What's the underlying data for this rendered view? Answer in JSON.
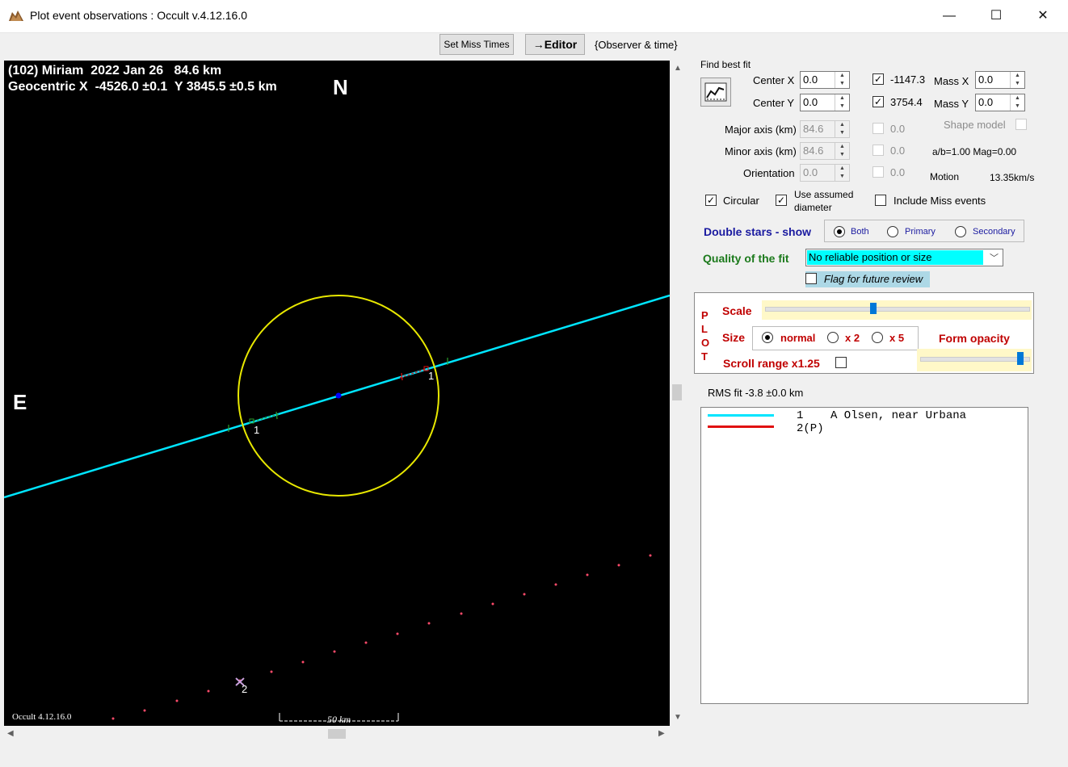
{
  "window": {
    "title": "Plot event observations : Occult v.4.12.16.0",
    "minimize": "—",
    "maximize": "☐",
    "close": "✕"
  },
  "toolbar": {
    "set_miss_times": "Set Miss Times",
    "editor": "→Editor",
    "observer_time": "{Observer & time}"
  },
  "plot": {
    "header_line1": "(102) Miriam  2022 Jan 26   84.6 km",
    "header_line2": "Geocentric X  -4526.0 ±0.1  Y 3845.5 ±0.5 km",
    "north": "N",
    "east": "E",
    "chord1_label_a": "1",
    "chord1_label_b": "1",
    "obs2_label": "2",
    "scale_label": "50 km",
    "version": "Occult 4.12.16.0",
    "colors": {
      "ellipse": "#e8e800",
      "chord1": "#00e5ff",
      "miss_dots": "#ff4a6a",
      "center": "#0000ff"
    }
  },
  "fit": {
    "find_best_fit": "Find best fit",
    "center_x_label": "Center X",
    "center_x_value": "0.0",
    "center_y_label": "Center Y",
    "center_y_value": "0.0",
    "fit_x_value": "-1147.3",
    "fit_y_value": "3754.4",
    "mass_x_label": "Mass X",
    "mass_x_value": "0.0",
    "mass_y_label": "Mass Y",
    "mass_y_value": "0.0",
    "major_axis_label": "Major axis (km)",
    "major_axis_value": "84.6",
    "minor_axis_label": "Minor axis (km)",
    "minor_axis_value": "84.6",
    "orientation_label": "Orientation",
    "orientation_value": "0.0",
    "major_chk_value": "0.0",
    "minor_chk_value": "0.0",
    "orient_chk_value": "0.0",
    "shape_model": "Shape model",
    "ab_mag": "a/b=1.00  Mag=0.00",
    "motion_label": "Motion",
    "motion_value": "13.35km/s",
    "circular": "Circular",
    "use_assumed": "Use assumed",
    "diameter": "diameter",
    "include_miss": "Include Miss events"
  },
  "double_stars": {
    "label": "Double stars - show",
    "both": "Both",
    "primary": "Primary",
    "secondary": "Secondary"
  },
  "quality": {
    "label": "Quality of the fit",
    "selected": "No reliable position or size",
    "flag": "Flag for future review"
  },
  "plot_settings": {
    "side_label": [
      "P",
      "L",
      "O",
      "T"
    ],
    "scale": "Scale",
    "scale_level": 0.41,
    "size": "Size",
    "size_normal": "normal",
    "size_x2": "x 2",
    "size_x5": "x 5",
    "form_opacity": "Form opacity",
    "opacity_level": 0.95,
    "scroll_range": "Scroll range x1.25"
  },
  "rms": "RMS fit -3.8 ±0.0 km",
  "legend": [
    {
      "color": "#00e5ff",
      "text": "1    A Olsen, near Urbana"
    },
    {
      "color": "#e01010",
      "text": "2(P)"
    }
  ]
}
